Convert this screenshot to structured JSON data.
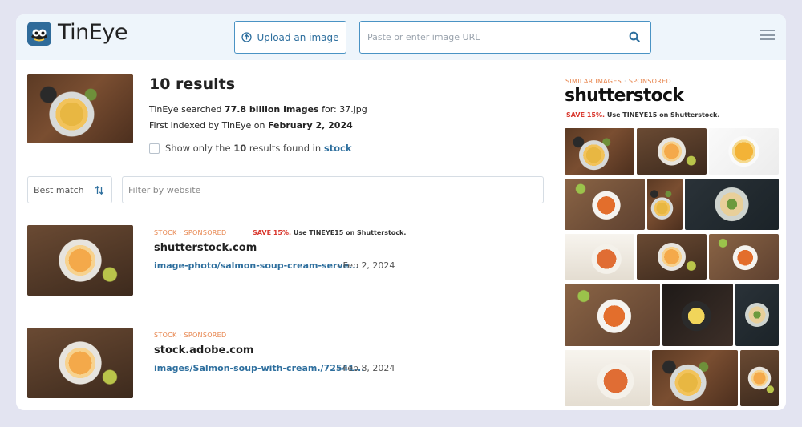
{
  "app": {
    "name": "TinEye"
  },
  "header": {
    "upload_label": "Upload an image",
    "url_placeholder": "Paste or enter image URL"
  },
  "summary": {
    "title": "10 results",
    "searched_prefix": "TinEye searched ",
    "searched_count": "77.8 billion images",
    "searched_suffix": " for: 37.jpg",
    "indexed_prefix": "First indexed by TinEye on ",
    "indexed_date": "February 2, 2024",
    "filter_prefix": "Show only the ",
    "filter_count": "10",
    "filter_middle": " results found in ",
    "filter_link": "stock"
  },
  "controls": {
    "sort_label": "Best match",
    "filter_placeholder": "Filter by website"
  },
  "results": [
    {
      "tag1": "STOCK",
      "tag2": "SPONSORED",
      "promo_red": "SAVE 15%.",
      "promo_rest": " Use TINEYE15 on Shutterstock.",
      "domain": "shutterstock.com",
      "path": "image-photo/salmon-soup-cream-serve...",
      "date": "- Feb 2, 2024"
    },
    {
      "tag1": "STOCK",
      "tag2": "SPONSORED",
      "domain": "stock.adobe.com",
      "path": "images/Salmon-soup-with-cream./72541...",
      "date": "- Feb 8, 2024"
    }
  ],
  "side": {
    "tag1": "SIMILAR IMAGES",
    "tag2": "SPONSORED",
    "brand": "shutterstock",
    "promo_red": "SAVE 15%.",
    "promo_rest": " Use TINEYE15 on Shutterstock."
  },
  "colors": {
    "accent": "#2e6f9e",
    "tag": "#e7844c",
    "promo_red": "#d9382e",
    "header_bg": "#eef5fb",
    "page_bg": "#e3e4f1"
  },
  "icons": [
    "upload-icon",
    "search-icon",
    "menu-icon",
    "sort-icon"
  ]
}
